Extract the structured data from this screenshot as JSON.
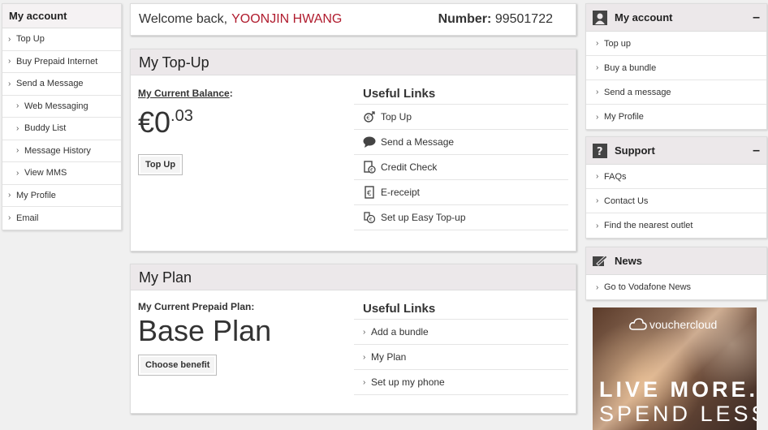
{
  "left_nav": {
    "title": "My account",
    "items": [
      {
        "label": "Top Up",
        "sub": false
      },
      {
        "label": "Buy Prepaid Internet",
        "sub": false
      },
      {
        "label": "Send a Message",
        "sub": false
      },
      {
        "label": "Web Messaging",
        "sub": true
      },
      {
        "label": "Buddy List",
        "sub": true
      },
      {
        "label": "Message History",
        "sub": true
      },
      {
        "label": "View MMS",
        "sub": true
      },
      {
        "label": "My Profile",
        "sub": false
      },
      {
        "label": "Email",
        "sub": false
      }
    ]
  },
  "welcome": {
    "prefix": "Welcome back,",
    "name": "YOONJIN HWANG",
    "number_label": "Number:",
    "number_value": "99501722"
  },
  "topup": {
    "title": "My Top-Up",
    "balance_label": "My Current Balance",
    "balance_colon": ":",
    "balance_main": "€0",
    "balance_cents": ".03",
    "button": "Top Up",
    "links_title": "Useful Links",
    "links": [
      {
        "label": "Top Up",
        "icon": "euro-arrow-icon"
      },
      {
        "label": "Send a Message",
        "icon": "speech-bubble-icon"
      },
      {
        "label": "Credit Check",
        "icon": "credit-check-icon"
      },
      {
        "label": "E-receipt",
        "icon": "e-receipt-icon"
      },
      {
        "label": "Set up Easy Top-up",
        "icon": "easy-topup-icon"
      }
    ]
  },
  "plan": {
    "title": "My Plan",
    "plan_label": "My Current Prepaid Plan:",
    "plan_name": "Base Plan",
    "button": "Choose benefit",
    "links_title": "Useful Links",
    "links": [
      {
        "label": "Add a bundle"
      },
      {
        "label": "My Plan"
      },
      {
        "label": "Set up my phone"
      }
    ]
  },
  "right": {
    "account": {
      "title": "My account",
      "items": [
        "Top up",
        "Buy a bundle",
        "Send a message",
        "My Profile"
      ]
    },
    "support": {
      "title": "Support",
      "items": [
        "FAQs",
        "Contact Us",
        "Find the nearest outlet"
      ]
    },
    "news": {
      "title": "News",
      "items": [
        "Go to Vodafone News"
      ]
    },
    "collapse_symbol": "–"
  },
  "ad": {
    "brand": "vouchercloud",
    "line1": "LIVE MORE.",
    "line2": "SPEND LESS."
  },
  "chevron": "›",
  "colors": {
    "accent_red": "#b01c2e",
    "header_bg": "#ece8ea"
  }
}
